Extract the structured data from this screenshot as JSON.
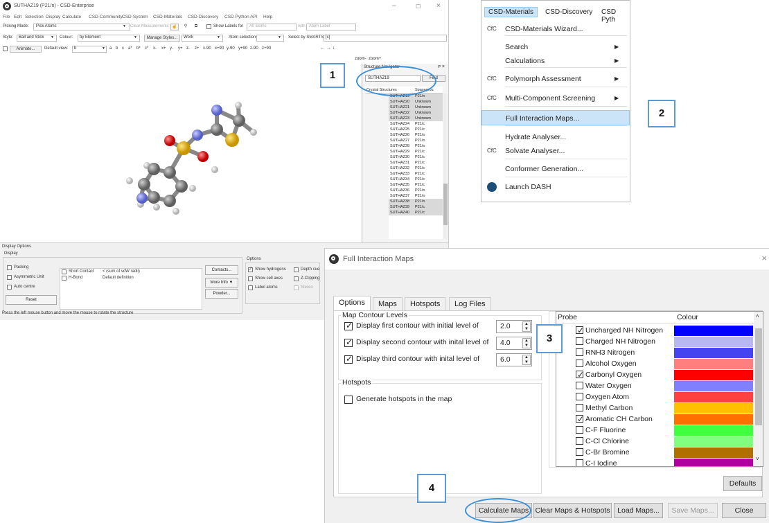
{
  "main_window": {
    "title": "SUTHAZ19 (P21/n) - CSD-Enterprise",
    "menus": [
      "File",
      "Edit",
      "Selection",
      "Display",
      "Calculate",
      "CSD-Community",
      "CSD-System",
      "CSD-Materials",
      "CSD-Discovery",
      "CSD Python API",
      "Help"
    ],
    "picking_mode_label": "Picking Mode:",
    "picking_mode_value": "Pick Atoms",
    "clear_measurements": "Clear Measurements",
    "show_labels_for": "Show Labels for",
    "show_labels_value": "All atoms",
    "with_label": "with",
    "atom_label_value": "Atom Label",
    "style_label": "Style:",
    "style_value": "Ball and Stick",
    "colour_label": "Colour:",
    "colour_value": "by Element",
    "manage_styles": "Manage Styles...",
    "work_value": "Work",
    "atom_selections": "Atom selections:",
    "select_by_smarts": "Select by SMARTS:",
    "smarts_value": "[c]",
    "animate": "Animate...",
    "default_view_label": "Default view:",
    "default_view_value": "b",
    "axes": [
      "a",
      "b",
      "c",
      "a*",
      "b*",
      "c*",
      "x-",
      "x+",
      "y-",
      "y+",
      "z-",
      "z+",
      "x-90",
      "x+90",
      "y-90",
      "y+90",
      "z-90",
      "z+90"
    ],
    "arrows": "← → ↓",
    "zoom_minus": "zoom-",
    "zoom_plus": "zoom+"
  },
  "structure_navigator": {
    "title": "Structure Navigator",
    "search_value": "SUTHAZ19",
    "find_label": "Find",
    "col_structures": "Crystal Structures",
    "col_spacegroup": "Spacegrou",
    "rows": [
      {
        "name": "SUTHAZ19",
        "sg": "P21/n"
      },
      {
        "name": "SUTHAZ20",
        "sg": "Unknown"
      },
      {
        "name": "SUTHAZ21",
        "sg": "Unknown"
      },
      {
        "name": "SUTHAZ22",
        "sg": "Unknown"
      },
      {
        "name": "SUTHAZ23",
        "sg": "Unknown"
      },
      {
        "name": "SUTHAZ24",
        "sg": "P21/c"
      },
      {
        "name": "SUTHAZ25",
        "sg": "P21/c"
      },
      {
        "name": "SUTHAZ26",
        "sg": "P21/n"
      },
      {
        "name": "SUTHAZ27",
        "sg": "P21/n"
      },
      {
        "name": "SUTHAZ28",
        "sg": "P21/n"
      },
      {
        "name": "SUTHAZ29",
        "sg": "P21/c"
      },
      {
        "name": "SUTHAZ30",
        "sg": "P21/c"
      },
      {
        "name": "SUTHAZ31",
        "sg": "P21/c"
      },
      {
        "name": "SUTHAZ32",
        "sg": "P21/c"
      },
      {
        "name": "SUTHAZ33",
        "sg": "P21/c"
      },
      {
        "name": "SUTHAZ34",
        "sg": "P21/c"
      },
      {
        "name": "SUTHAZ35",
        "sg": "P21/c"
      },
      {
        "name": "SUTHAZ36",
        "sg": "P21/n"
      },
      {
        "name": "SUTHAZ37",
        "sg": "P21/n"
      },
      {
        "name": "SUTHAZ38",
        "sg": "P21/n"
      },
      {
        "name": "SUTHAZ39",
        "sg": "P21/c"
      },
      {
        "name": "SUTHAZ40",
        "sg": "P21/c"
      }
    ]
  },
  "display_options": {
    "title": "Display Options",
    "display_group": "Display",
    "packing": "Packing",
    "asymmetric_unit": "Asymmetric Unit",
    "auto_centre": "Auto centre",
    "reset": "Reset",
    "short_contact": "Short Contact",
    "short_contact_def": "< (sum of vdW radii)",
    "h_bond": "H-Bond",
    "h_bond_def": "Default definition",
    "contacts": "Contacts...",
    "more_info": "More Info ▼",
    "powder": "Powder...",
    "options_group": "Options",
    "show_hydrogens": "Show hydrogens",
    "depth_cue": "Depth cue",
    "show_cell_axes": "Show cell axes",
    "z_clipping": "Z-Clipping",
    "label_atoms": "Label atoms",
    "stereo": "Stereo",
    "status": "Press the left mouse button and move the mouse to rotate the structure"
  },
  "menu": {
    "bar": [
      "CSD-Materials",
      "CSD-Discovery",
      "CSD Pyth"
    ],
    "items": [
      {
        "icon": "CfC",
        "label": "CSD-Materials Wizard...",
        "arrow": ""
      },
      {
        "icon": "",
        "label": "Search",
        "arrow": "▶"
      },
      {
        "icon": "",
        "label": "Calculations",
        "arrow": "▶"
      },
      {
        "icon": "CfC",
        "label": "Polymorph Assessment",
        "arrow": "▶"
      },
      {
        "icon": "CfC",
        "label": "Multi-Component Screening",
        "arrow": "▶"
      },
      {
        "icon": "",
        "label": "Full Interaction Maps...",
        "arrow": ""
      },
      {
        "icon": "",
        "label": "Hydrate Analyser...",
        "arrow": ""
      },
      {
        "icon": "CfC",
        "label": "Solvate Analyser...",
        "arrow": ""
      },
      {
        "icon": "",
        "label": "Conformer Generation...",
        "arrow": ""
      },
      {
        "icon": "",
        "label": "Launch DASH",
        "arrow": ""
      }
    ]
  },
  "dialog": {
    "title": "Full Interaction Maps",
    "tabs": [
      "Options",
      "Maps",
      "Hotspots",
      "Log Files"
    ],
    "contour_group": "Map Contour Levels",
    "contour1": "Display first contour with initial level of",
    "contour1_value": "2.0",
    "contour2": "Display second contour with inital level of",
    "contour2_value": "4.0",
    "contour3": "Display third contour with inital level of",
    "contour3_value": "6.0",
    "hotspots_group": "Hotspots",
    "generate_hotspots": "Generate hotspots in the map",
    "probe_header": "Probe",
    "colour_header": "Colour",
    "probes": [
      {
        "name": "Uncharged NH Nitrogen",
        "checked": true,
        "color": "#0000ff"
      },
      {
        "name": "Charged NH Nitrogen",
        "checked": false,
        "color": "#b8b8f0"
      },
      {
        "name": "RNH3 Nitrogen",
        "checked": false,
        "color": "#4444f0"
      },
      {
        "name": "Alcohol Oxygen",
        "checked": false,
        "color": "#ff7f7f"
      },
      {
        "name": "Carbonyl Oxygen",
        "checked": true,
        "color": "#ff0000"
      },
      {
        "name": "Water Oxygen",
        "checked": false,
        "color": "#8080ff"
      },
      {
        "name": "Oxygen Atom",
        "checked": false,
        "color": "#ff4040"
      },
      {
        "name": "Methyl Carbon",
        "checked": false,
        "color": "#ffc000"
      },
      {
        "name": "Aromatic CH Carbon",
        "checked": true,
        "color": "#ff7000"
      },
      {
        "name": "C-F Fluorine",
        "checked": false,
        "color": "#40ff40"
      },
      {
        "name": "C-Cl Chlorine",
        "checked": false,
        "color": "#80ff80"
      },
      {
        "name": "C-Br Bromine",
        "checked": false,
        "color": "#b07000"
      },
      {
        "name": "C-I Iodine",
        "checked": false,
        "color": "#b000a0"
      }
    ],
    "defaults": "Defaults",
    "calculate_maps": "Calculate Maps",
    "clear_maps": "Clear Maps & Hotspots",
    "load_maps": "Load Maps...",
    "save_maps": "Save Maps...",
    "close": "Close"
  },
  "callouts": [
    "1",
    "2",
    "3",
    "4"
  ]
}
